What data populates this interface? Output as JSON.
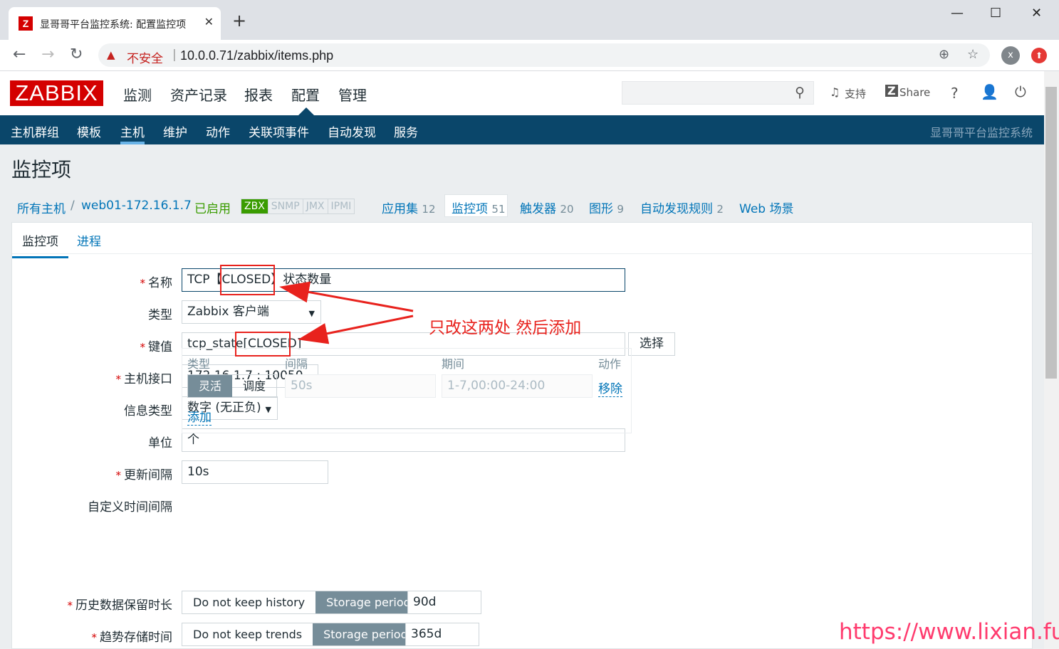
{
  "browser": {
    "tab_title": "显哥哥平台监控系统: 配置监控项",
    "tab_close": "✕",
    "newtab": "+",
    "favicon": "Z",
    "insecure": "不安全",
    "url": "10.0.0.71/zabbix/items.php",
    "avatar": "x",
    "window_controls": [
      "—",
      "☐",
      "✕"
    ]
  },
  "header": {
    "logo": "ZABBIX",
    "menu": [
      "监测",
      "资产记录",
      "报表",
      "配置",
      "管理"
    ],
    "support": "支持",
    "share": "Share",
    "help": "?"
  },
  "subnav": {
    "items": [
      "主机群组",
      "模板",
      "主机",
      "维护",
      "动作",
      "关联项事件",
      "自动发现",
      "服务"
    ],
    "system_name": "显哥哥平台监控系统"
  },
  "page": {
    "title": "监控项",
    "breadcrumb": {
      "all_hosts": "所有主机",
      "sep": "/",
      "host": "web01-172.16.1.7",
      "status": "已启用",
      "availability": [
        "ZBX",
        "SNMP",
        "JMX",
        "IPMI"
      ],
      "apps": "应用集",
      "apps_count": "12",
      "items": "监控项",
      "items_count": "51",
      "triggers": "触发器",
      "triggers_count": "20",
      "graphs": "图形",
      "graphs_count": "9",
      "discovery": "自动发现规则",
      "discovery_count": "2",
      "web": "Web 场景"
    }
  },
  "form": {
    "tabs": [
      "监控项",
      "进程"
    ],
    "required_mark": "*",
    "name_label": "名称",
    "name_value": "TCP【CLOSED】状态数量",
    "type_label": "类型",
    "type_value": "Zabbix 客户端",
    "key_label": "键值",
    "key_value": "tcp_state[CLOSED]",
    "key_select": "选择",
    "iface_label": "主机接口",
    "iface_value": "172.16.1.7 : 10050",
    "info_label": "信息类型",
    "info_value": "数字 (无正负)",
    "unit_label": "单位",
    "unit_value": "个",
    "interval_label": "更新间隔",
    "interval_value": "10s",
    "custom_label": "自定义时间间隔",
    "custom": {
      "headers": [
        "类型",
        "间隔",
        "期间",
        "动作"
      ],
      "mode_flexible": "灵活",
      "mode_schedule": "调度",
      "interval_placeholder": "50s",
      "period_placeholder": "1-7,00:00-24:00",
      "remove": "移除",
      "add": "添加"
    },
    "history_label": "历史数据保留时长",
    "history_opts": [
      "Do not keep history",
      "Storage period"
    ],
    "history_value": "90d",
    "trends_label": "趋势存储时间",
    "trends_opts": [
      "Do not keep trends",
      "Storage period"
    ],
    "trends_value": "365d"
  },
  "annotation": {
    "text": "只改这两处 然后添加",
    "color": "#e8221d"
  },
  "watermark": "https://www.lixian.fun"
}
